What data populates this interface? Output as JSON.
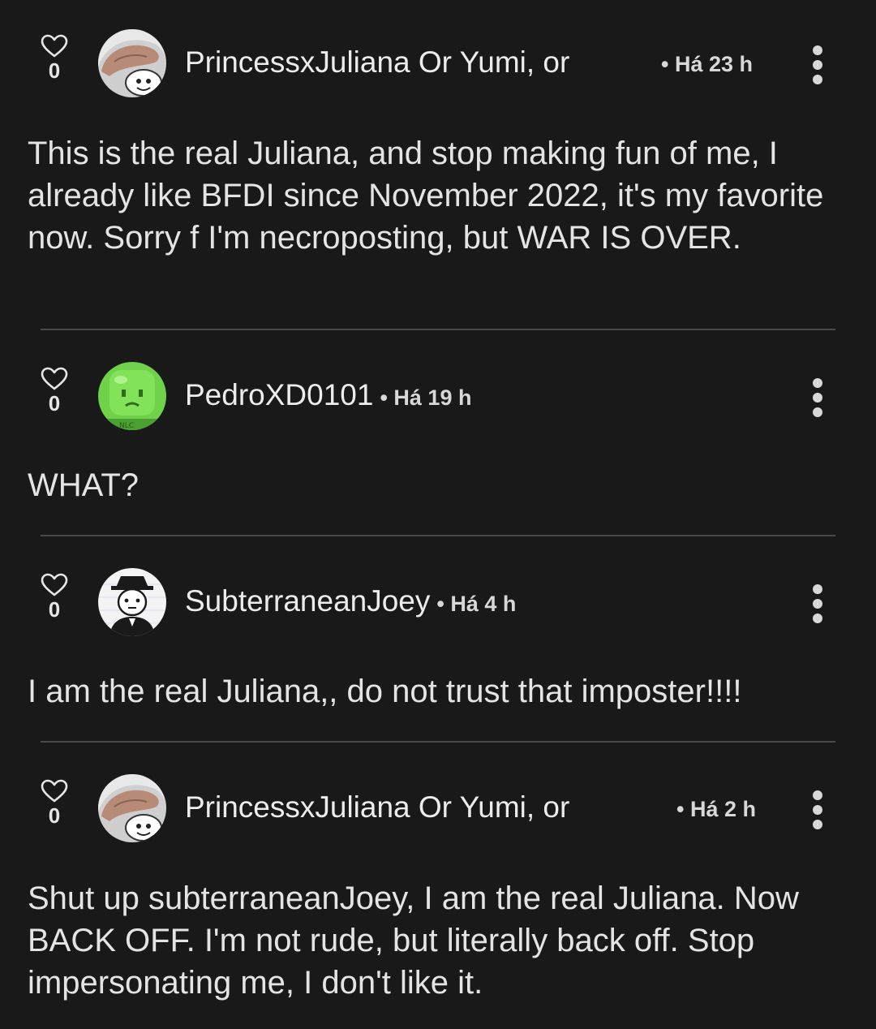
{
  "comments": [
    {
      "likes": "0",
      "author": "PrincessxJuliana Or Yumi, or",
      "time": "• Há 23 h",
      "text": "This is the real Juliana, and stop making fun of me, I already like BFDI since November 2022, it's my favorite now. Sorry f I'm necroposting, but WAR IS OVER.",
      "avatar": "hand-avatar"
    },
    {
      "likes": "0",
      "author": "PedroXD0101",
      "time": "• Há 19 h",
      "text": "WHAT?",
      "avatar": "green-blob-avatar"
    },
    {
      "likes": "0",
      "author": "SubterraneanJoey",
      "time": "• Há 4 h",
      "text": "I am the real Juliana,, do not trust that imposter!!!!",
      "avatar": "sketch-avatar"
    },
    {
      "likes": "0",
      "author": "PrincessxJuliana Or Yumi, or",
      "time": "• Há 2 h",
      "text": "Shut up subterraneanJoey, I am the real Juliana. Now BACK OFF. I'm not rude, but literally back off. Stop impersonating me, I don't like it.",
      "avatar": "hand-avatar"
    }
  ],
  "icons": {
    "like": "heart-outline-icon",
    "more": "vertical-dots-icon"
  },
  "colors": {
    "background": "#191919",
    "text": "#e6e6e6",
    "divider": "#4a4a4a"
  }
}
